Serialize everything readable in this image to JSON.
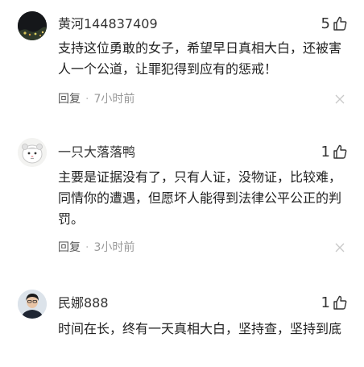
{
  "comments": [
    {
      "username": "黄河144837409",
      "likes": "5",
      "content": "支持这位勇敢的女子，希望早日真相大白，还被害人一个公道，让罪犯得到应有的惩戒！",
      "reply_label": "回复",
      "separator": "·",
      "time": "7小时前",
      "avatar_icon": "dark-avatar-icon"
    },
    {
      "username": "一只大落落鸭",
      "likes": "1",
      "content": "主要是证据没有了，只有人证，没物证，比较难，同情你的遭遇，但愿坏人能得到法律公平公正的判罚。",
      "reply_label": "回复",
      "separator": "·",
      "time": "3小时前",
      "avatar_icon": "hamster-avatar-icon"
    },
    {
      "username": "民娜888",
      "likes": "1",
      "content": "时间在长，终有一天真相大白，坚持查，坚持到底",
      "avatar_icon": "person-avatar-icon"
    }
  ],
  "colors": {
    "text": "#222222",
    "meta": "#888888",
    "icon": "#333333",
    "close": "#c8c8c8"
  }
}
